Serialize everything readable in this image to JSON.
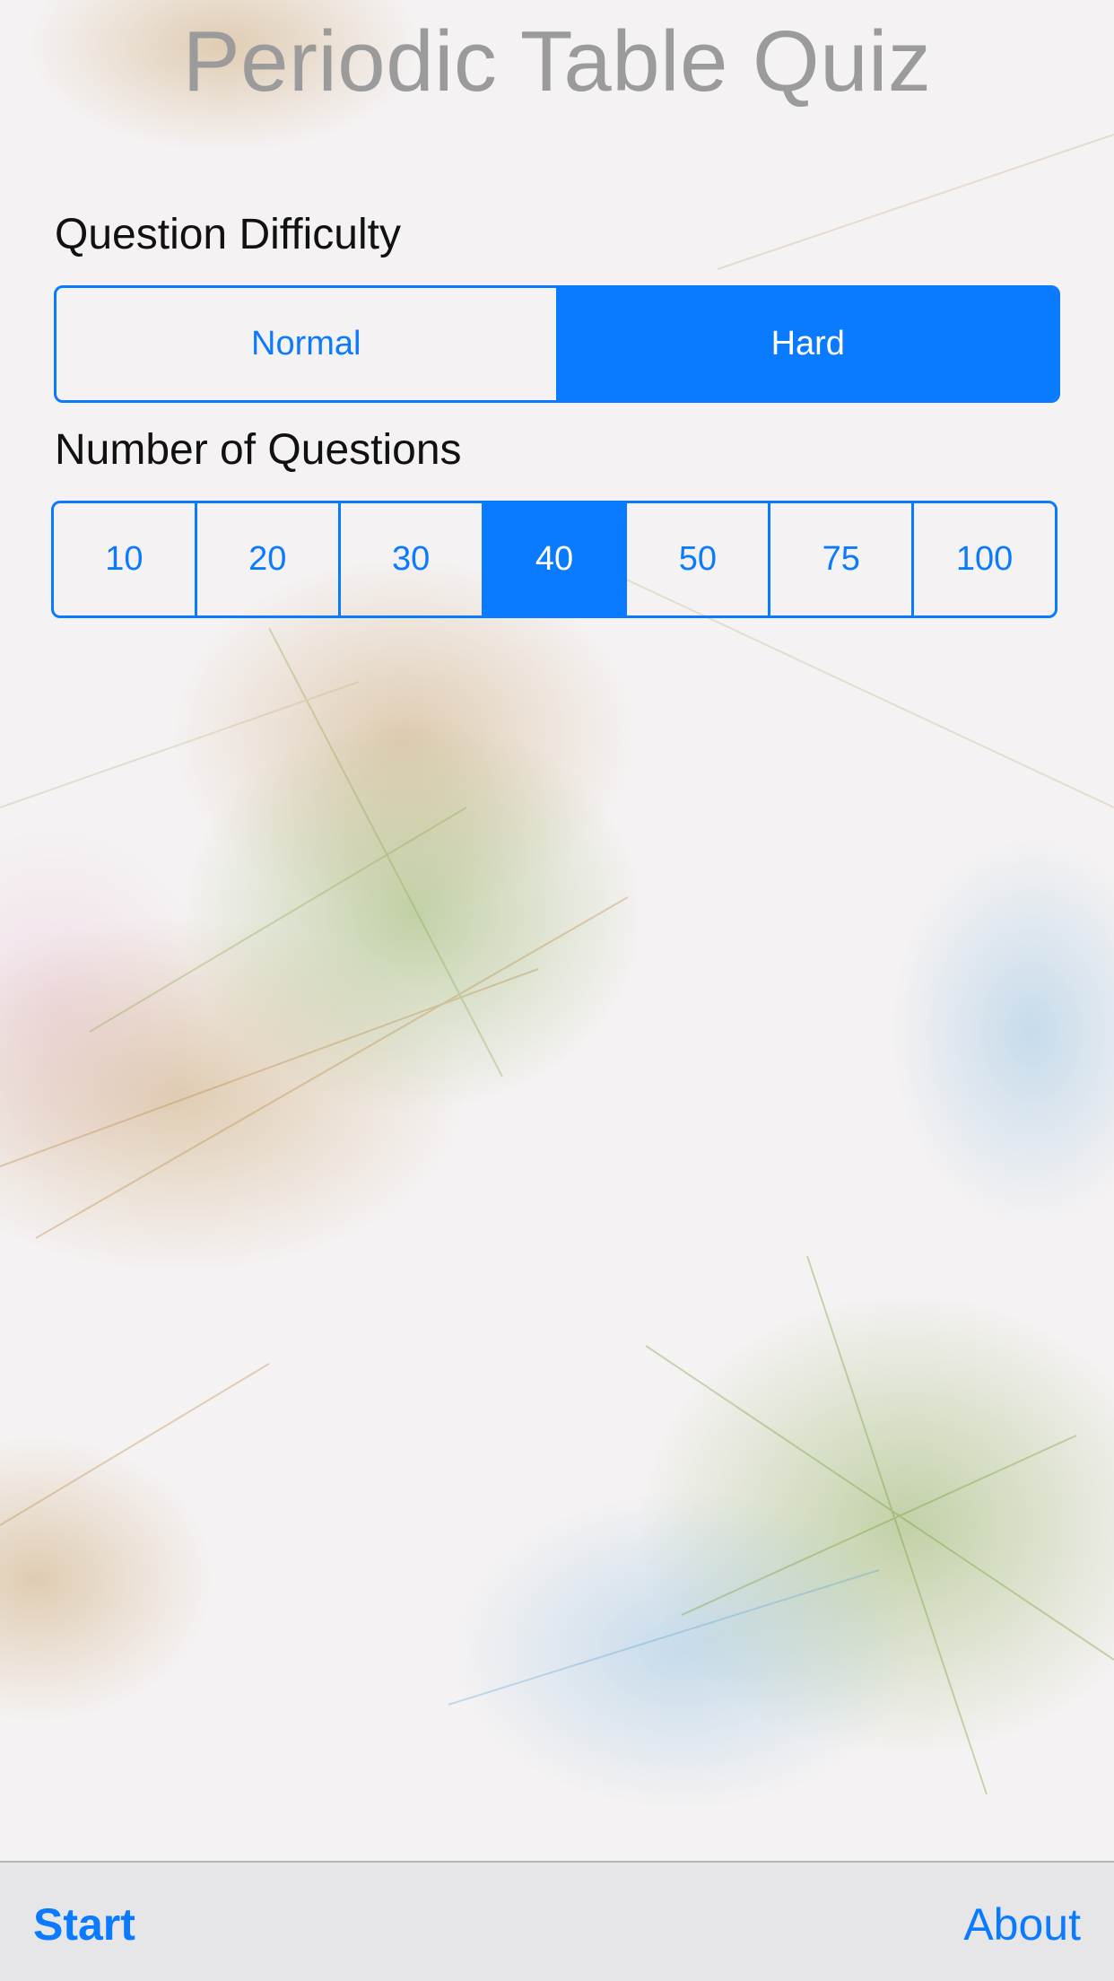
{
  "app": {
    "title": "Periodic Table Quiz"
  },
  "difficulty": {
    "label": "Question Difficulty",
    "options": [
      "Normal",
      "Hard"
    ],
    "selected": "Hard"
  },
  "question_count": {
    "label": "Number of Questions",
    "options": [
      "10",
      "20",
      "30",
      "40",
      "50",
      "75",
      "100"
    ],
    "selected": "40"
  },
  "toolbar": {
    "start_label": "Start",
    "about_label": "About"
  },
  "colors": {
    "accent": "#0a7aff",
    "title": "#9b9b9b",
    "toolbar_background": "#e6e6e8"
  }
}
